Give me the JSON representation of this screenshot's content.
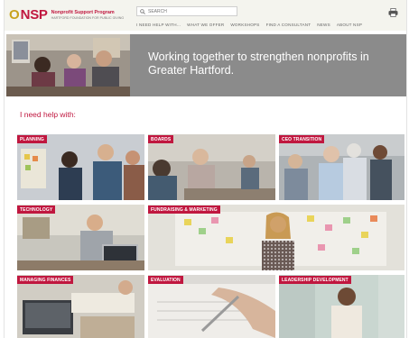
{
  "brand": {
    "logo_mark": "O",
    "logo_text": "NSP",
    "title": "Nonprofit Support Program",
    "tagline": "HARTFORD FOUNDATION FOR PUBLIC GIVING",
    "primary_color": "#c0173f",
    "accent_color": "#c8a21e"
  },
  "search": {
    "placeholder": "SEARCH"
  },
  "nav": {
    "items": [
      "I NEED HELP WITH...",
      "WHAT WE OFFER",
      "WORKSHOPS",
      "FIND A CONSULTANT",
      "NEWS",
      "ABOUT NSP"
    ]
  },
  "hero": {
    "text": "Working together to strengthen nonprofits in Greater Hartford."
  },
  "help": {
    "heading": "I need help with:",
    "tiles": [
      "PLANNING",
      "BOARDS",
      "CEO TRANSITION",
      "TECHNOLOGY",
      "FUNDRAISING & MARKETING",
      "MANAGING FINANCES",
      "EVALUATION",
      "LEADERSHIP DEVELOPMENT"
    ]
  },
  "icons": {
    "search": "search-icon",
    "print": "print-icon"
  }
}
